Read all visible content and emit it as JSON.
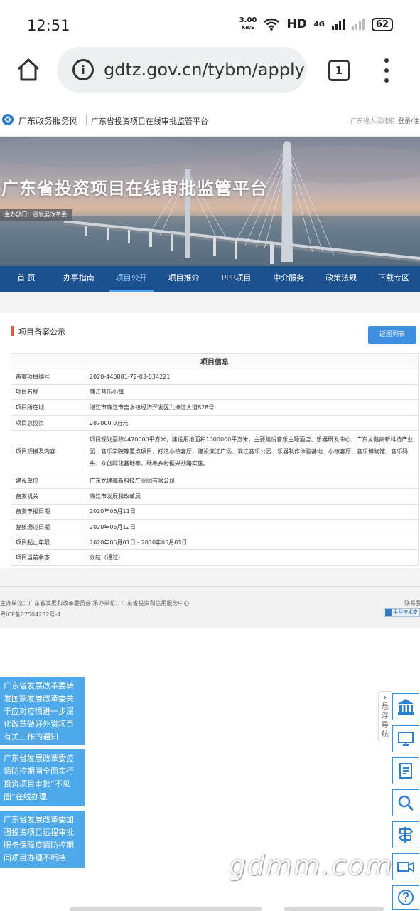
{
  "status_bar": {
    "time": "12:51",
    "speed_value": "3.00",
    "speed_unit": "KB/S",
    "hd": "HD",
    "network": "4G",
    "battery": "62"
  },
  "browser": {
    "url": "gdtz.gov.cn/tybm/apply",
    "tab_count": "1"
  },
  "site_header": {
    "site_name": "广东政务服务网",
    "platform_name": "广东省投资项目在线审批监管平台",
    "gov_link": "广东省人民政府",
    "login_link": "登录/注"
  },
  "banner": {
    "title": "广东省投资项目在线审批监管平台",
    "dept": "主办部门：省发展改革委"
  },
  "nav": {
    "items": [
      "首 页",
      "办事指南",
      "项目公开",
      "项目推介",
      "PPP项目",
      "中介服务",
      "政策法规",
      "下载专区"
    ],
    "active_index": 2
  },
  "card": {
    "title": "项目备案公示",
    "return_button": "返回列表",
    "table_header": "项目信息",
    "rows": [
      {
        "key": "备案项目编号",
        "value": "2020-440881-72-03-034221"
      },
      {
        "key": "项目名称",
        "value": "廉江音乐小镇"
      },
      {
        "key": "项目所在地",
        "value": "湛江市廉江市吉水镇经济开发区九洲江大道828号"
      },
      {
        "key": "项目总投资",
        "value": "287000.0万元"
      },
      {
        "key": "项目规模及内容",
        "value": "项目规划面积4470000平方米，建设用地面积1000000平方米，主要建设音乐主题酒店、乐器研发中心、广东龙健高新科技产业园、音乐学院等重点项目，打造小镇客厅，建设滨江广场、滨江音乐公园、乐器制作体验基地、小镇客厅、音乐博物馆、音乐码头、众创孵化基地等，助奉乡村振兴战略实施。"
      },
      {
        "key": "建设单位",
        "value": "广东龙健高新科技产业园有限公司"
      },
      {
        "key": "备案机关",
        "value": "廉江市发展和改革局"
      },
      {
        "key": "备案申报日期",
        "value": "2020年05月11日"
      },
      {
        "key": "复核通过日期",
        "value": "2020年05月12日"
      },
      {
        "key": "项目起止年限",
        "value": "2020年05月01日 - 2030年05月01日"
      },
      {
        "key": "项目当前状态",
        "value": "办结（通过）"
      }
    ]
  },
  "footer": {
    "host": "主办单位：广东省发展和改革委员会    承办单位：广东省投资和信用服务中心",
    "contact": "联系我",
    "icp": "粤ICP备07504232号-4",
    "badge": "平台技术支"
  },
  "notices": [
    "广东省发展改革委转发国家发展改革委关于应对疫情进一步深化改革做好外资项目有关工作的通知",
    "广东省发展改革委疫情防控期间全面实行投资项目审批“不见面”在线办理",
    "广东省发展改革委加强投资项目远程审批服务保障疫情防控期间项目办理不断档"
  ],
  "side_guide": {
    "arrow": "›",
    "label": "悬浮导航"
  },
  "side_icons": [
    "bank-icon",
    "screen-icon",
    "document-icon",
    "search-icon",
    "signpost-icon",
    "video-icon",
    "help-icon"
  ],
  "watermark": "gdmm.com",
  "colors": {
    "nav_bg": "#1b4f8e",
    "accent_blue": "#3e8fdf",
    "notice_blue": "#4ea9ea",
    "title_marker": "#e8593e"
  }
}
